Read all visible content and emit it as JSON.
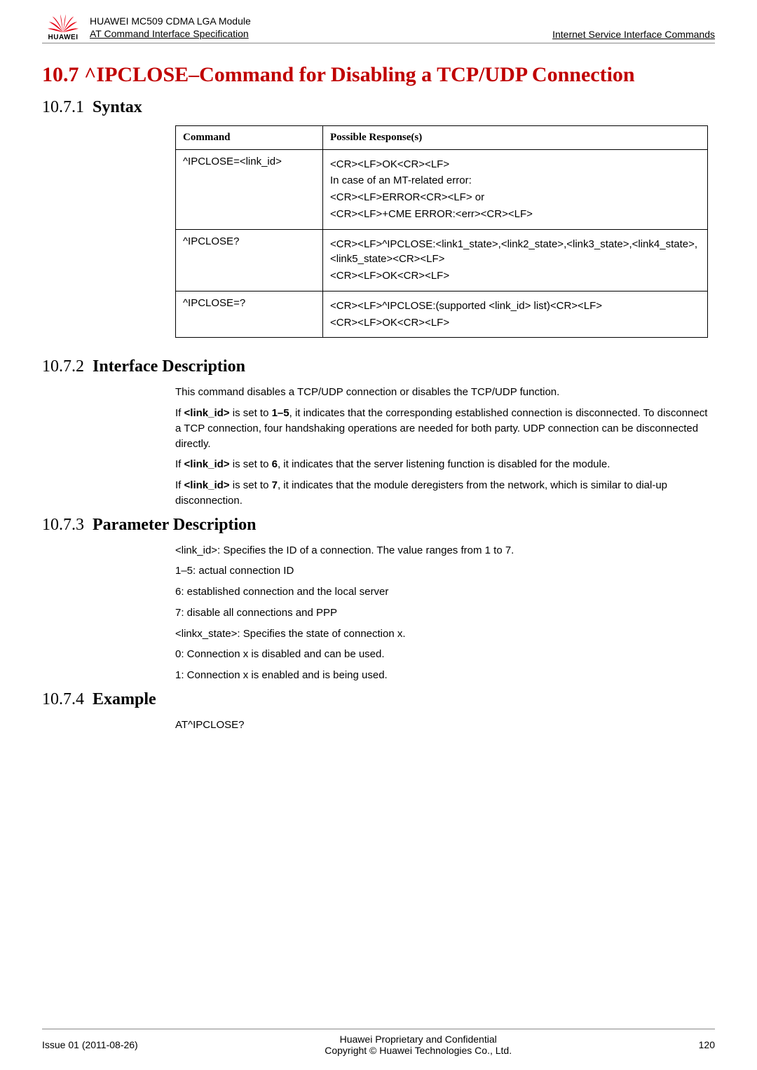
{
  "header": {
    "logo_text": "HUAWEI",
    "title_line1": "HUAWEI MC509 CDMA LGA Module",
    "title_line2": "AT Command Interface Specification",
    "right": "Internet Service Interface Commands"
  },
  "section": {
    "title": "10.7 ^IPCLOSE–Command for Disabling a TCP/UDP Connection"
  },
  "syntax": {
    "num": "10.7.1",
    "label": "Syntax",
    "th_command": "Command",
    "th_response": "Possible Response(s)",
    "rows": [
      {
        "command": "^IPCLOSE=<link_id>",
        "responses": [
          "<CR><LF>OK<CR><LF>",
          "In case of an MT-related error:",
          "<CR><LF>ERROR<CR><LF> or",
          "<CR><LF>+CME ERROR:<err><CR><LF>"
        ]
      },
      {
        "command": "^IPCLOSE?",
        "responses": [
          "<CR><LF>^IPCLOSE:<link1_state>,<link2_state>,<link3_state>,<link4_state>,<link5_state><CR><LF>",
          "<CR><LF>OK<CR><LF>"
        ]
      },
      {
        "command": "^IPCLOSE=?",
        "responses": [
          "<CR><LF>^IPCLOSE:(supported <link_id> list)<CR><LF>",
          "<CR><LF>OK<CR><LF>"
        ]
      }
    ]
  },
  "interface_desc": {
    "num": "10.7.2",
    "label": "Interface Description",
    "p1": "This command disables a TCP/UDP connection or disables the TCP/UDP function.",
    "p2_pre": "If ",
    "p2_bold1": "<link_id>",
    "p2_mid": " is set to ",
    "p2_bold2": "1–5",
    "p2_post": ", it indicates that the corresponding established connection is disconnected. To disconnect a TCP connection, four handshaking operations are needed for both party. UDP connection can be disconnected directly.",
    "p3_pre": "If ",
    "p3_bold1": "<link_id>",
    "p3_mid": " is set to ",
    "p3_bold2": "6",
    "p3_post": ", it indicates that the server listening function is disabled for the module.",
    "p4_pre": "If ",
    "p4_bold1": "<link_id>",
    "p4_mid": " is set to ",
    "p4_bold2": "7",
    "p4_post": ", it indicates that the module deregisters from the network, which is similar to dial-up disconnection."
  },
  "param_desc": {
    "num": "10.7.3",
    "label": "Parameter Description",
    "lines": [
      "<link_id>: Specifies the ID of a connection. The value ranges from 1 to 7.",
      "1–5: actual connection ID",
      "6: established connection and the local server",
      "7: disable all connections and PPP",
      "<linkx_state>: Specifies the state of connection x.",
      "0: Connection x is disabled and can be used.",
      "1: Connection x is enabled and is being used."
    ]
  },
  "example": {
    "num": "10.7.4",
    "label": "Example",
    "line": "AT^IPCLOSE?"
  },
  "footer": {
    "left": "Issue 01 (2011-08-26)",
    "center1": "Huawei Proprietary and Confidential",
    "center2": "Copyright © Huawei Technologies Co., Ltd.",
    "right": "120"
  }
}
